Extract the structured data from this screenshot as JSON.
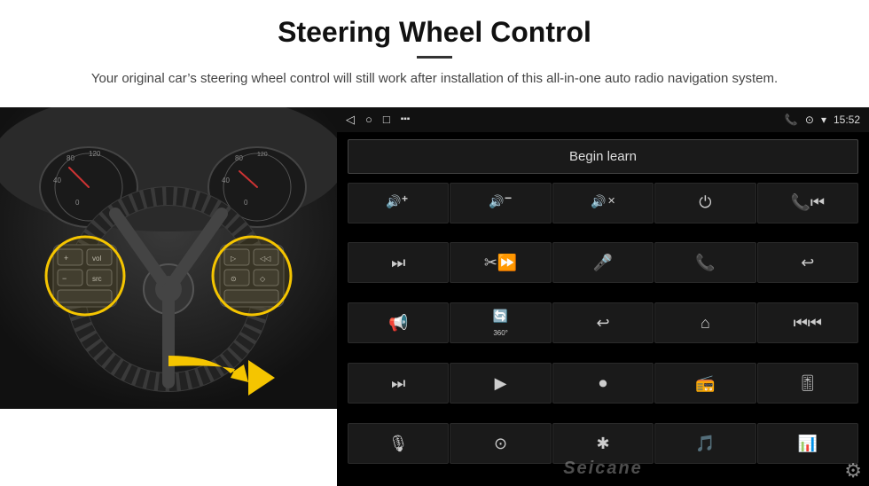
{
  "header": {
    "title": "Steering Wheel Control",
    "divider": true,
    "subtitle": "Your original car’s steering wheel control will still work after installation of this all-in-one auto radio navigation system."
  },
  "status_bar": {
    "left_icons": [
      "◁",
      "○",
      "□",
      "▪▪"
    ],
    "right_icons": [
      "📞",
      "⊙",
      "▾",
      "15:52"
    ]
  },
  "begin_learn": {
    "label": "Begin learn"
  },
  "control_buttons": [
    {
      "icon": "🔊+",
      "label": "vol-up"
    },
    {
      "icon": "🔊-",
      "label": "vol-down"
    },
    {
      "icon": "🔇",
      "label": "mute"
    },
    {
      "icon": "⏻",
      "label": "power"
    },
    {
      "icon": "⏮",
      "label": "prev-track"
    },
    {
      "icon": "⏭",
      "label": "next"
    },
    {
      "icon": "✂⏩",
      "label": "skip"
    },
    {
      "icon": "🎤",
      "label": "mic"
    },
    {
      "icon": "📞",
      "label": "call"
    },
    {
      "icon": "↩",
      "label": "hang-up"
    },
    {
      "icon": "📢",
      "label": "speaker"
    },
    {
      "icon": "🔄",
      "label": "360"
    },
    {
      "icon": "↩",
      "label": "back"
    },
    {
      "icon": "🏠",
      "label": "home"
    },
    {
      "icon": "⏮⏮",
      "label": "rewind"
    },
    {
      "icon": "⏭⏭",
      "label": "fast-fwd"
    },
    {
      "icon": "▶",
      "label": "nav"
    },
    {
      "icon": "⏺",
      "label": "source"
    },
    {
      "icon": "📻",
      "label": "radio"
    },
    {
      "icon": "🎚",
      "label": "eq"
    },
    {
      "icon": "🎙",
      "label": "mic2"
    },
    {
      "icon": "⊙",
      "label": "settings2"
    },
    {
      "icon": "✱",
      "label": "bt"
    },
    {
      "icon": "🎵",
      "label": "music"
    },
    {
      "icon": "📊",
      "label": "spectrum"
    }
  ],
  "watermark": "Seicane",
  "gear_icon": "⚙"
}
